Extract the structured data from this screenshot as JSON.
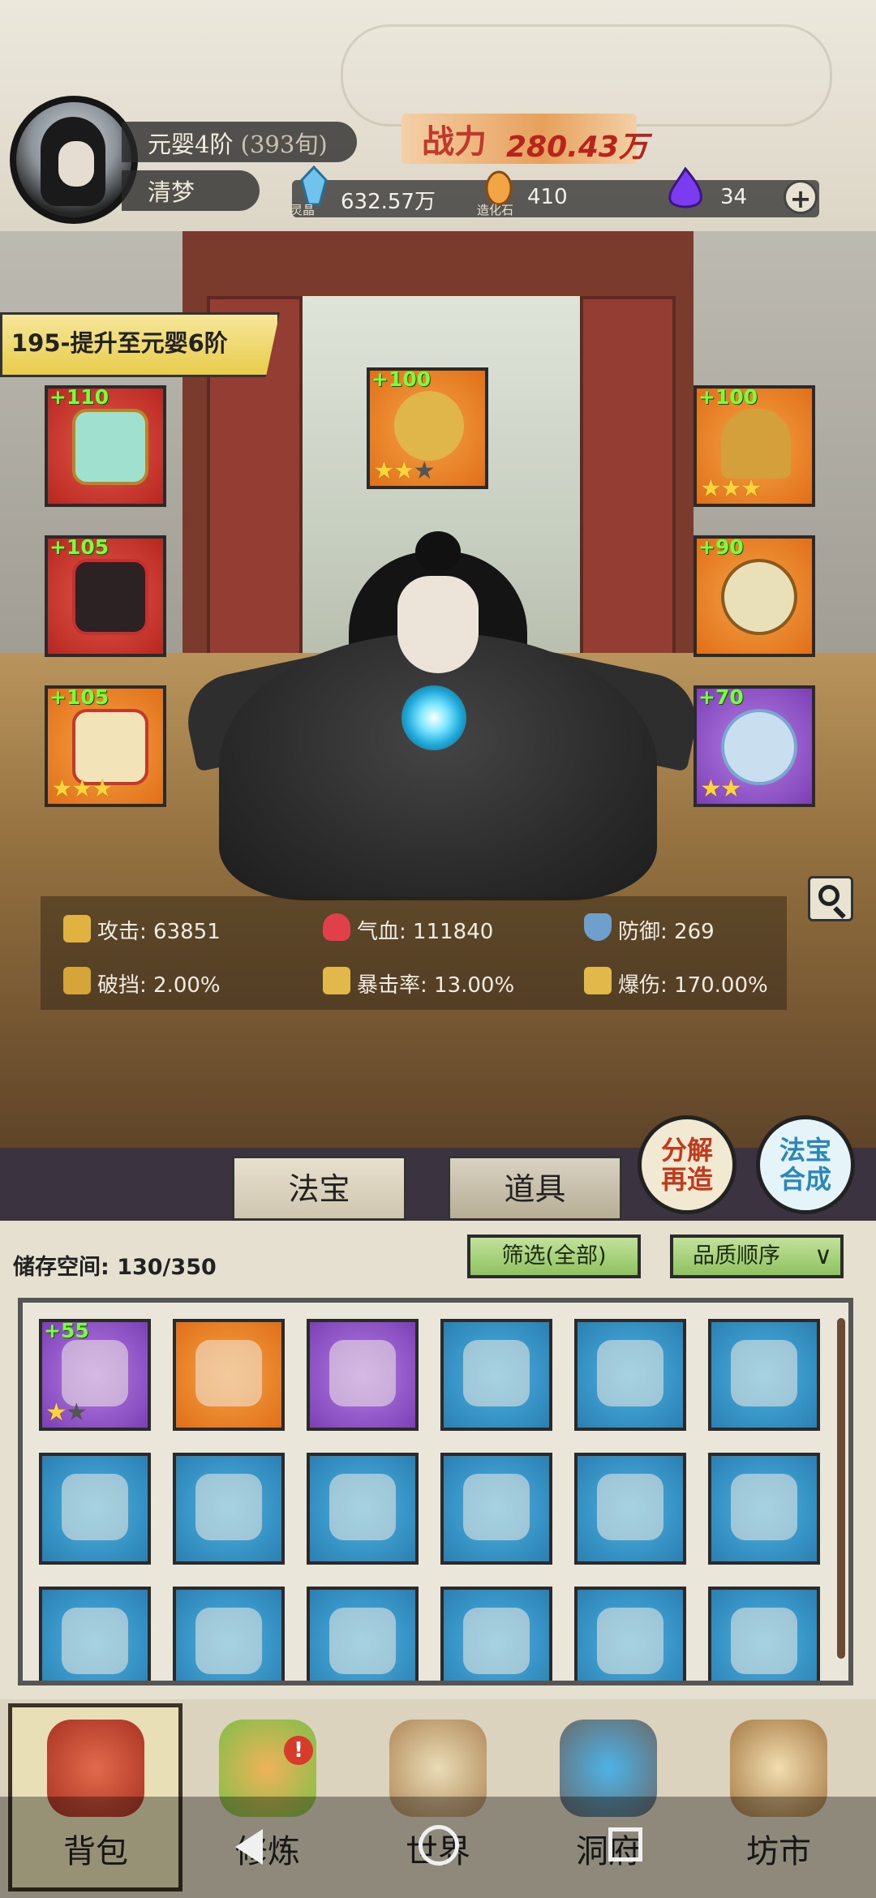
{
  "player": {
    "realm": "元婴4阶",
    "years": "(393旬)",
    "name": "清梦"
  },
  "power": {
    "label": "战力",
    "value": "280.43万"
  },
  "resources": [
    {
      "icon": "spirit-crystal-icon",
      "value": "632.57万",
      "caption": "灵晶"
    },
    {
      "icon": "creation-stone-icon",
      "value": "410",
      "caption": "造化石"
    },
    {
      "icon": "purple-flame-icon",
      "value": "34",
      "caption": ""
    }
  ],
  "quest": {
    "text": "195-提升至元婴6阶"
  },
  "equipment": [
    {
      "name": "fan-artifact",
      "plus": "+110",
      "color": "red",
      "stars": 0
    },
    {
      "name": "golden-dragon-artifact",
      "plus": "+100",
      "color": "orange",
      "stars": 2,
      "max_stars": 3
    },
    {
      "name": "crown-artifact",
      "plus": "+100",
      "color": "orange",
      "stars": 3
    },
    {
      "name": "robe-artifact",
      "plus": "+105",
      "color": "red",
      "stars": 0
    },
    {
      "name": "pendant-artifact",
      "plus": "+90",
      "color": "orange",
      "stars": 0
    },
    {
      "name": "boots-artifact",
      "plus": "+105",
      "color": "orange",
      "stars": 3
    },
    {
      "name": "bracelet-artifact",
      "plus": "+70",
      "color": "purple",
      "stars": 2
    }
  ],
  "stats": [
    {
      "label": "攻击:",
      "value": "63851",
      "icon": "sword-icon"
    },
    {
      "label": "气血:",
      "value": "111840",
      "icon": "heart-icon"
    },
    {
      "label": "防御:",
      "value": "269",
      "icon": "shield-icon"
    },
    {
      "label": "破挡:",
      "value": "2.00%",
      "icon": "break-icon"
    },
    {
      "label": "暴击率:",
      "value": "13.00%",
      "icon": "crit-icon"
    },
    {
      "label": "爆伤:",
      "value": "170.00%",
      "icon": "crit-damage-icon"
    }
  ],
  "tabs": [
    {
      "label": "法宝"
    },
    {
      "label": "道具"
    }
  ],
  "actions": {
    "decompose": "分解再造",
    "synthesize": "法宝合成"
  },
  "inventory": {
    "storage": "储存空间: 130/350",
    "filter": "筛选(全部)",
    "sort": "品质顺序",
    "items": [
      {
        "icon": "ring-icon",
        "color": "purple",
        "plus": "+55",
        "stars": 1,
        "max_stars": 2
      },
      {
        "icon": "amulet-icon",
        "color": "orange",
        "plus": "",
        "stars": 0
      },
      {
        "icon": "ring-icon",
        "color": "purple",
        "plus": "",
        "stars": 0
      },
      {
        "icon": "dagger-icon",
        "color": "blue",
        "plus": "",
        "stars": 0
      },
      {
        "icon": "dagger-icon",
        "color": "blue",
        "plus": "",
        "stars": 0
      },
      {
        "icon": "sword-icon",
        "color": "blue",
        "plus": "",
        "stars": 0
      },
      {
        "icon": "bow-icon",
        "color": "blue",
        "plus": "",
        "stars": 0
      },
      {
        "icon": "axe-icon",
        "color": "blue",
        "plus": "",
        "stars": 0
      },
      {
        "icon": "staff-icon",
        "color": "blue",
        "plus": "",
        "stars": 0
      },
      {
        "icon": "fan-icon",
        "color": "blue",
        "plus": "",
        "stars": 0
      },
      {
        "icon": "fan-icon",
        "color": "blue",
        "plus": "",
        "stars": 0
      },
      {
        "icon": "crown-icon",
        "color": "blue",
        "plus": "",
        "stars": 0
      },
      {
        "icon": "armor-icon",
        "color": "blue",
        "plus": "",
        "stars": 0
      },
      {
        "icon": "armor-icon",
        "color": "blue",
        "plus": "",
        "stars": 0
      },
      {
        "icon": "mask-icon",
        "color": "blue",
        "plus": "",
        "stars": 0
      },
      {
        "icon": "mask-icon",
        "color": "blue",
        "plus": "",
        "stars": 0
      },
      {
        "icon": "chestplate-icon",
        "color": "blue",
        "plus": "",
        "stars": 0
      },
      {
        "icon": "helmet-icon",
        "color": "blue",
        "plus": "",
        "stars": 0
      }
    ]
  },
  "nav": [
    {
      "label": "背包",
      "icon": "bag-icon"
    },
    {
      "label": "修炼",
      "icon": "lotus-icon"
    },
    {
      "label": "世界",
      "icon": "scroll-icon"
    },
    {
      "label": "洞府",
      "icon": "portal-icon"
    },
    {
      "label": "坊市",
      "icon": "market-icon"
    }
  ]
}
